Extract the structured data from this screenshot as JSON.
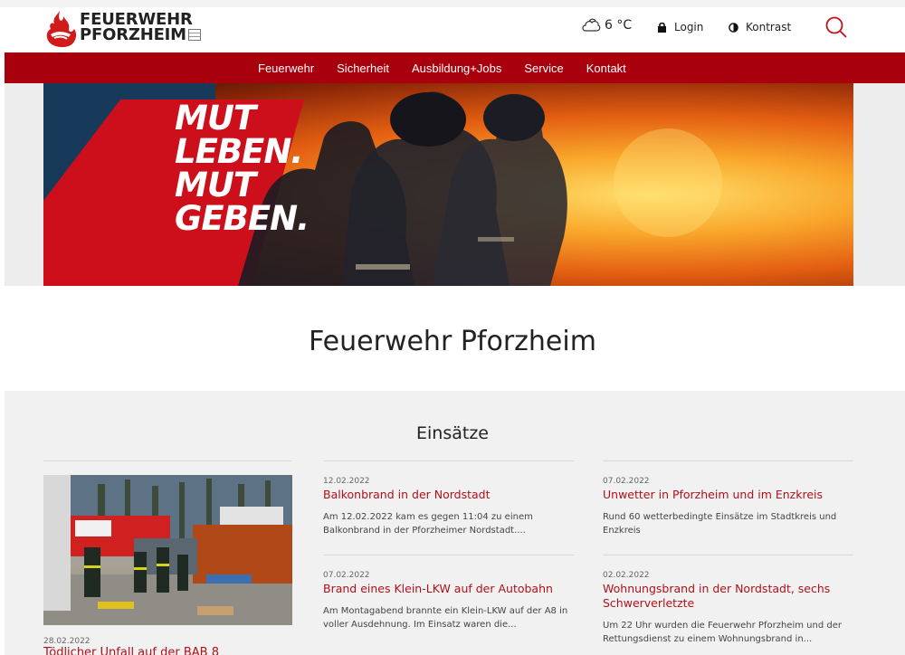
{
  "header": {
    "logo_line1": "FEUERWEHR",
    "logo_line2": "PFORZHEIM",
    "weather": "6 °C",
    "login_label": "Login",
    "contrast_label": "Kontrast"
  },
  "nav": {
    "items": [
      {
        "label": "Feuerwehr"
      },
      {
        "label": "Sicherheit"
      },
      {
        "label": "Ausbildung+Jobs"
      },
      {
        "label": "Service"
      },
      {
        "label": "Kontakt"
      }
    ]
  },
  "hero": {
    "lines": [
      "MUT",
      "LEBEN.",
      "MUT",
      "GEBEN."
    ]
  },
  "page_title": "Feuerwehr Pforzheim",
  "einsaetze": {
    "title": "Einsätze",
    "featured": {
      "date": "28.02.2022",
      "title": "Tödlicher Unfall auf der BAB 8"
    },
    "cards": [
      {
        "date": "12.02.2022",
        "title": "Balkonbrand in der Nordstadt",
        "text": "Am 12.02.2022 kam es gegen 11:04 zu einem Balkonbrand in der Pforzheimer Nordstadt...."
      },
      {
        "date": "07.02.2022",
        "title": "Unwetter in Pforzheim und im Enzkreis",
        "text": "Rund 60 wetterbedingte Einsätze im Stadtkreis und Enzkreis"
      },
      {
        "date": "07.02.2022",
        "title": "Brand eines Klein-LKW auf der Autobahn",
        "text": "Am Montagabend brannte ein Klein-LKW auf der A8 in voller Ausdehnung. Im Einsatz waren die..."
      },
      {
        "date": "02.02.2022",
        "title": "Wohnungsbrand in der Nordstadt, sechs Schwerverletzte",
        "text": "Um 22 Uhr wurden die Feuerwehr Pforzheim und der Rettungsdienst zu einem Wohnungsbrand in..."
      }
    ]
  },
  "colors": {
    "brand_red": "#a8000c",
    "link_red": "#b0101a"
  }
}
